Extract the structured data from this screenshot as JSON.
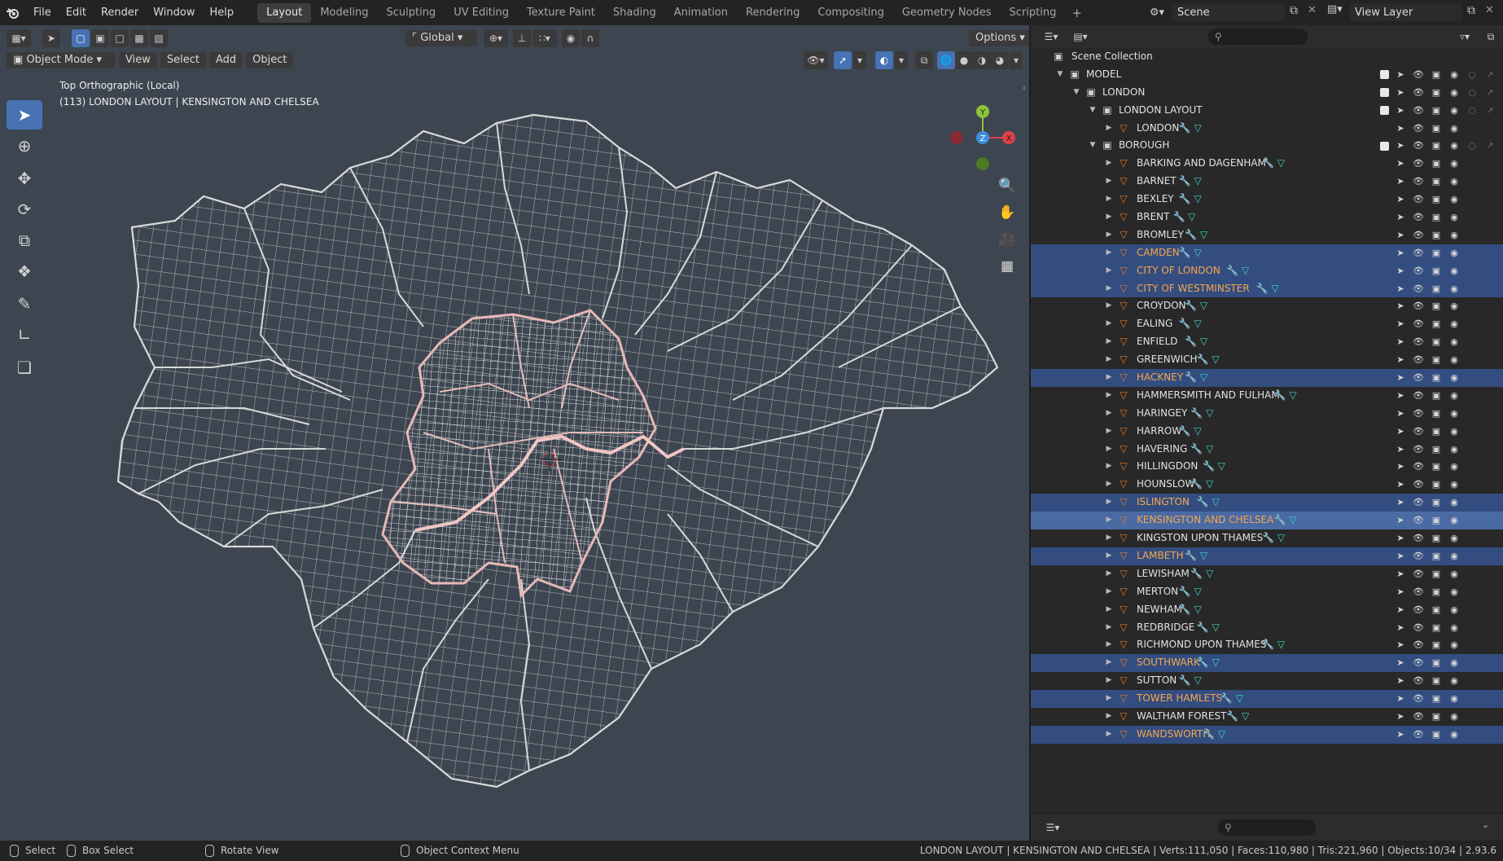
{
  "menu": [
    "File",
    "Edit",
    "Render",
    "Window",
    "Help"
  ],
  "workspaces": [
    "Layout",
    "Modeling",
    "Sculpting",
    "UV Editing",
    "Texture Paint",
    "Shading",
    "Animation",
    "Rendering",
    "Compositing",
    "Geometry Nodes",
    "Scripting"
  ],
  "workspace_add": "+",
  "scene_name": "Scene",
  "view_layer_name": "View Layer",
  "viewport": {
    "transform_orientation": "Global",
    "options_label": "Options",
    "mode": "Object Mode",
    "header_menus": [
      "View",
      "Select",
      "Add",
      "Object"
    ],
    "view_name": "Top Orthographic (Local)",
    "object_info": "(113) LONDON LAYOUT | KENSINGTON AND CHELSEA",
    "gizmo_axes": {
      "x": "X",
      "y": "Y",
      "z": "Z"
    }
  },
  "outliner": {
    "root": "Scene Collection",
    "collections": [
      {
        "name": "MODEL",
        "depth": 0
      },
      {
        "name": "LONDON",
        "depth": 1
      },
      {
        "name": "LONDON LAYOUT",
        "depth": 2
      },
      {
        "name": "BOROUGH",
        "depth": 2
      }
    ],
    "london_object": "LONDON",
    "boroughs": [
      {
        "name": "BARKING AND DAGENHAM",
        "state": ""
      },
      {
        "name": "BARNET",
        "state": ""
      },
      {
        "name": "BEXLEY",
        "state": ""
      },
      {
        "name": "BRENT",
        "state": ""
      },
      {
        "name": "BROMLEY",
        "state": ""
      },
      {
        "name": "CAMDEN",
        "state": "sel"
      },
      {
        "name": "CITY OF LONDON",
        "state": "sel"
      },
      {
        "name": "CITY OF WESTMINSTER",
        "state": "sel"
      },
      {
        "name": "CROYDON",
        "state": ""
      },
      {
        "name": "EALING",
        "state": ""
      },
      {
        "name": "ENFIELD",
        "state": ""
      },
      {
        "name": "GREENWICH",
        "state": ""
      },
      {
        "name": "HACKNEY",
        "state": "sel"
      },
      {
        "name": "HAMMERSMITH AND FULHAM",
        "state": ""
      },
      {
        "name": "HARINGEY",
        "state": ""
      },
      {
        "name": "HARROW",
        "state": ""
      },
      {
        "name": "HAVERING",
        "state": ""
      },
      {
        "name": "HILLINGDON",
        "state": ""
      },
      {
        "name": "HOUNSLOW",
        "state": ""
      },
      {
        "name": "ISLINGTON",
        "state": "sel"
      },
      {
        "name": "KENSINGTON AND CHELSEA",
        "state": "active"
      },
      {
        "name": "KINGSTON UPON THAMES",
        "state": ""
      },
      {
        "name": "LAMBETH",
        "state": "sel"
      },
      {
        "name": "LEWISHAM",
        "state": ""
      },
      {
        "name": "MERTON",
        "state": ""
      },
      {
        "name": "NEWHAM",
        "state": ""
      },
      {
        "name": "REDBRIDGE",
        "state": ""
      },
      {
        "name": "RICHMOND UPON THAMES",
        "state": ""
      },
      {
        "name": "SOUTHWARK",
        "state": "sel"
      },
      {
        "name": "SUTTON",
        "state": ""
      },
      {
        "name": "TOWER HAMLETS",
        "state": "sel"
      },
      {
        "name": "WALTHAM FOREST",
        "state": ""
      },
      {
        "name": "WANDSWORTH",
        "state": "sel"
      }
    ]
  },
  "statusbar": {
    "select": "Select",
    "box_select": "Box Select",
    "rotate_view": "Rotate View",
    "context_menu": "Object Context Menu",
    "stats": "LONDON LAYOUT | KENSINGTON AND CHELSEA | Verts:111,050 | Faces:110,980 | Tris:221,960 | Objects:10/34 | 2.93.6"
  },
  "colors": {
    "accent": "#4772b3",
    "selected_text": "#f5a64c",
    "viewport_bg": "#3d4650",
    "mesh_object": "#e07b2c",
    "modifier_icon": "#7da7de",
    "mesh_data_icon": "#3fd6c6"
  }
}
